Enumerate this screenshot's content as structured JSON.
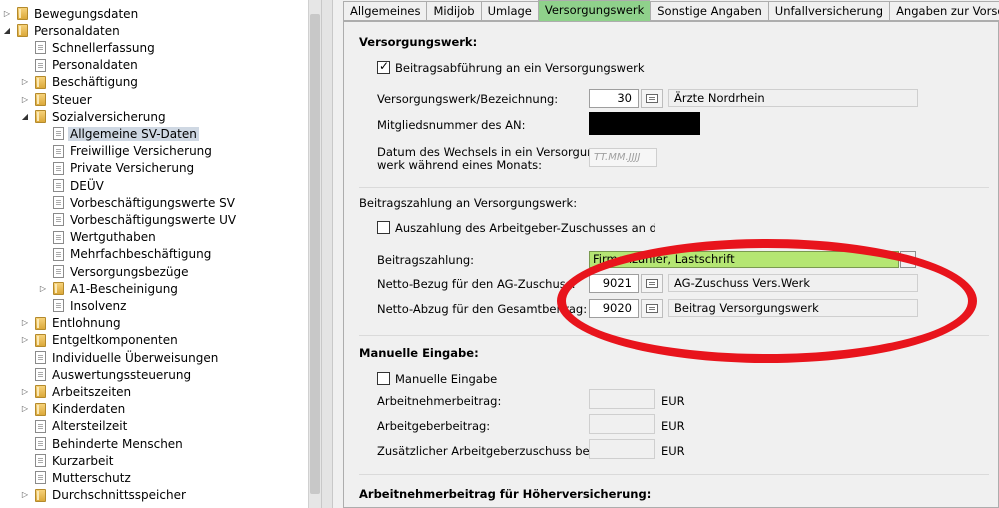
{
  "tree": {
    "items": [
      {
        "label": "Bewegungsdaten",
        "level": 0,
        "toggle": "collapsed",
        "icon": "folder"
      },
      {
        "label": "Personaldaten",
        "level": 0,
        "toggle": "expanded",
        "icon": "folder"
      },
      {
        "label": "Schnellerfassung",
        "level": 1,
        "toggle": "none",
        "icon": "doc"
      },
      {
        "label": "Personaldaten",
        "level": 1,
        "toggle": "none",
        "icon": "doc"
      },
      {
        "label": "Beschäftigung",
        "level": 1,
        "toggle": "collapsed",
        "icon": "folder"
      },
      {
        "label": "Steuer",
        "level": 1,
        "toggle": "collapsed",
        "icon": "folder"
      },
      {
        "label": "Sozialversicherung",
        "level": 1,
        "toggle": "expanded",
        "icon": "folder"
      },
      {
        "label": "Allgemeine SV-Daten",
        "level": 2,
        "toggle": "none",
        "icon": "doc",
        "selected": true
      },
      {
        "label": "Freiwillige Versicherung",
        "level": 2,
        "toggle": "none",
        "icon": "doc"
      },
      {
        "label": "Private Versicherung",
        "level": 2,
        "toggle": "none",
        "icon": "doc"
      },
      {
        "label": "DEÜV",
        "level": 2,
        "toggle": "none",
        "icon": "doc"
      },
      {
        "label": "Vorbeschäftigungswerte SV",
        "level": 2,
        "toggle": "none",
        "icon": "doc"
      },
      {
        "label": "Vorbeschäftigungswerte UV",
        "level": 2,
        "toggle": "none",
        "icon": "doc"
      },
      {
        "label": "Wertguthaben",
        "level": 2,
        "toggle": "none",
        "icon": "doc"
      },
      {
        "label": "Mehrfachbeschäftigung",
        "level": 2,
        "toggle": "none",
        "icon": "doc"
      },
      {
        "label": "Versorgungsbezüge",
        "level": 2,
        "toggle": "none",
        "icon": "doc"
      },
      {
        "label": "A1-Bescheinigung",
        "level": 2,
        "toggle": "collapsed",
        "icon": "folder"
      },
      {
        "label": "Insolvenz",
        "level": 2,
        "toggle": "none",
        "icon": "doc"
      },
      {
        "label": "Entlohnung",
        "level": 1,
        "toggle": "collapsed",
        "icon": "folder"
      },
      {
        "label": "Entgeltkomponenten",
        "level": 1,
        "toggle": "collapsed",
        "icon": "folder"
      },
      {
        "label": "Individuelle Überweisungen",
        "level": 1,
        "toggle": "none",
        "icon": "doc"
      },
      {
        "label": "Auswertungssteuerung",
        "level": 1,
        "toggle": "none",
        "icon": "doc"
      },
      {
        "label": "Arbeitszeiten",
        "level": 1,
        "toggle": "collapsed",
        "icon": "folder"
      },
      {
        "label": "Kinderdaten",
        "level": 1,
        "toggle": "collapsed",
        "icon": "folder"
      },
      {
        "label": "Altersteilzeit",
        "level": 1,
        "toggle": "none",
        "icon": "doc"
      },
      {
        "label": "Behinderte Menschen",
        "level": 1,
        "toggle": "none",
        "icon": "doc"
      },
      {
        "label": "Kurzarbeit",
        "level": 1,
        "toggle": "none",
        "icon": "doc"
      },
      {
        "label": "Mutterschutz",
        "level": 1,
        "toggle": "none",
        "icon": "doc"
      },
      {
        "label": "Durchschnittsspeicher",
        "level": 1,
        "toggle": "collapsed",
        "icon": "folder"
      }
    ]
  },
  "tabs": [
    {
      "label": "Allgemeines",
      "active": false
    },
    {
      "label": "Midijob",
      "active": false
    },
    {
      "label": "Umlage",
      "active": false
    },
    {
      "label": "Versorgungswerk",
      "active": true
    },
    {
      "label": "Sonstige Angaben",
      "active": false
    },
    {
      "label": "Unfallversicherung",
      "active": false
    },
    {
      "label": "Angaben zur Vorsorgepauschale",
      "active": false
    }
  ],
  "form": {
    "section_versorgungswerk": "Versorgungswerk:",
    "cb_beitragsabfuehrung": "Beitragsabführung an ein Versorgungswerk",
    "cb_beitragsabfuehrung_checked": true,
    "versorgungswerk_label": "Versorgungswerk/Bezeichnung:",
    "versorgungswerk_num": "30",
    "versorgungswerk_name": "Ärzte Nordrhein",
    "mitgliedsnummer_label": "Mitgliedsnummer des AN:",
    "datum_label_1": "Datum des Wechsels in ein Versorgungs-",
    "datum_label_2": "werk während eines Monats:",
    "datum_placeholder": "TT.MM.JJJJ",
    "section_beitragszahlung": "Beitragszahlung an Versorgungswerk:",
    "cb_auszahlung": "Auszahlung des Arbeitgeber-Zuschusses an den Arbeitnehmer",
    "beitragszahlung_label": "Beitragszahlung:",
    "beitragszahlung_value": "Firmenzahler, Lastschrift",
    "netto_bezug_label": "Netto-Bezug für den AG-Zuschuss:",
    "netto_bezug_num": "9021",
    "netto_bezug_name": "AG-Zuschuss Vers.Werk",
    "netto_abzug_label": "Netto-Abzug für den Gesamtbeitrag:",
    "netto_abzug_num": "9020",
    "netto_abzug_name": "Beitrag Versorgungswerk",
    "section_manuelle": "Manuelle Eingabe:",
    "cb_manuelle": "Manuelle Eingabe",
    "an_beitrag_label": "Arbeitnehmerbeitrag:",
    "ag_beitrag_label": "Arbeitgeberbeitrag:",
    "zusaetzlich_label": "Zusätzlicher Arbeitgeberzuschuss bei ATZ:",
    "currency": "EUR",
    "section_hoeher": "Arbeitnehmerbeitrag für Höherversicherung:"
  },
  "colors": {
    "active_tab": "#8fd18b",
    "combo_highlight": "#b5e673",
    "annotation_ellipse": "#e8141c",
    "tree_selection": "#cfd8e3"
  }
}
